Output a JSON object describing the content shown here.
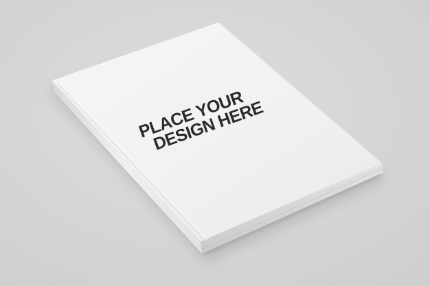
{
  "image": {
    "subject": "book-cover-mockup",
    "background_color": "#d6d6d6",
    "cover_color": "#f1f1f1",
    "text_color": "#2b2b2b"
  },
  "cover": {
    "line1": "PLACE YOUR",
    "line2": "DESIGN HERE"
  }
}
